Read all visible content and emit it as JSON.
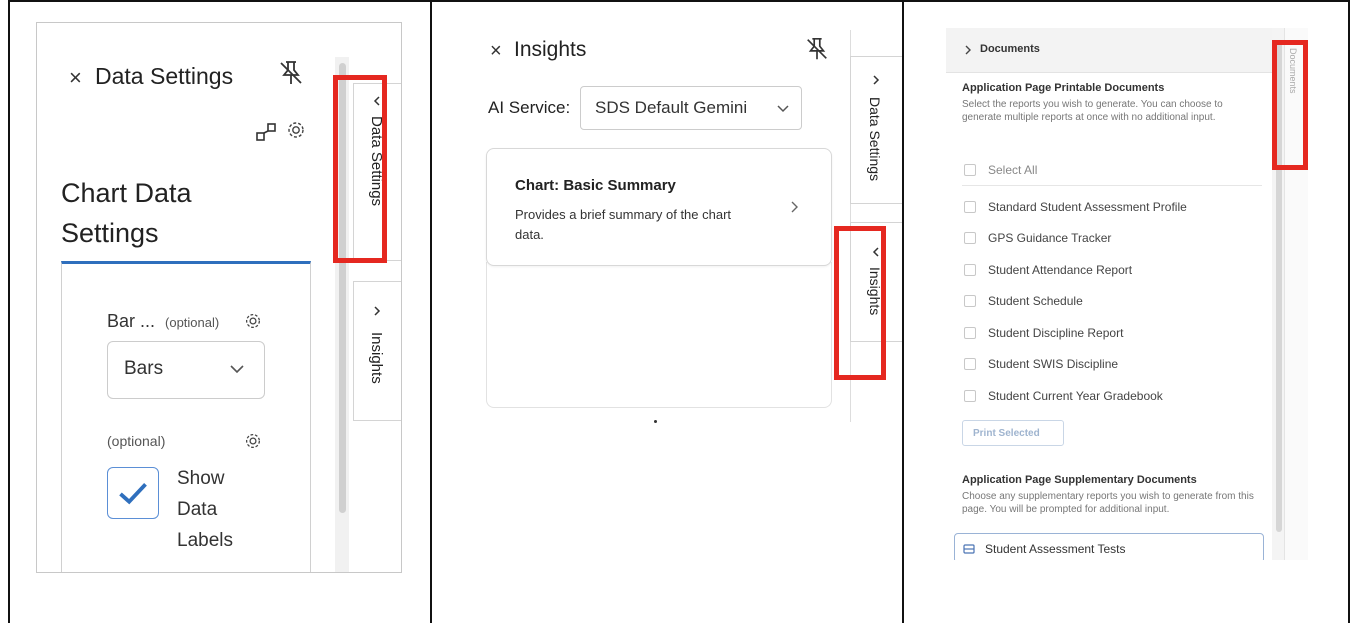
{
  "panel1": {
    "close_glyph": "×",
    "title": "Data Settings",
    "heading": "Chart Data Settings",
    "bar_label": "Bar ...",
    "bar_optional": "(optional)",
    "select_value": "Bars",
    "labels_optional": "(optional)",
    "checkbox_label": "Show Data Labels",
    "checkbox_checked": true,
    "tab_data_settings": "Data Settings",
    "tab_insights": "Insights",
    "accent_color": "#2f6fbd",
    "highlight_color": "#e52820"
  },
  "panel2": {
    "close_glyph": "×",
    "title": "Insights",
    "ai_service_label": "AI Service:",
    "ai_service_value": "SDS Default Gemini",
    "card_title": "Chart: Basic Summary",
    "card_desc": "Provides a brief summary of the chart data.",
    "tab_data_settings": "Data Settings",
    "tab_insights": "Insights"
  },
  "panel3": {
    "header_title": "Documents",
    "sec1_title": "Application Page Printable Documents",
    "sec1_desc": "Select the reports you wish to generate. You can choose to generate multiple reports at once with no additional input.",
    "select_all": "Select All",
    "items": [
      "Standard Student Assessment Profile",
      "GPS Guidance Tracker",
      "Student Attendance Report",
      "Student Schedule",
      "Student Discipline Report",
      "Student SWIS Discipline",
      "Student Current Year Gradebook"
    ],
    "print_button": "Print Selected",
    "sec2_title": "Application Page Supplementary Documents",
    "sec2_desc": "Choose any supplementary reports you wish to generate from this page. You will be prompted for additional input.",
    "assessment_item": "Student Assessment Tests",
    "side_tab": "Documents"
  }
}
